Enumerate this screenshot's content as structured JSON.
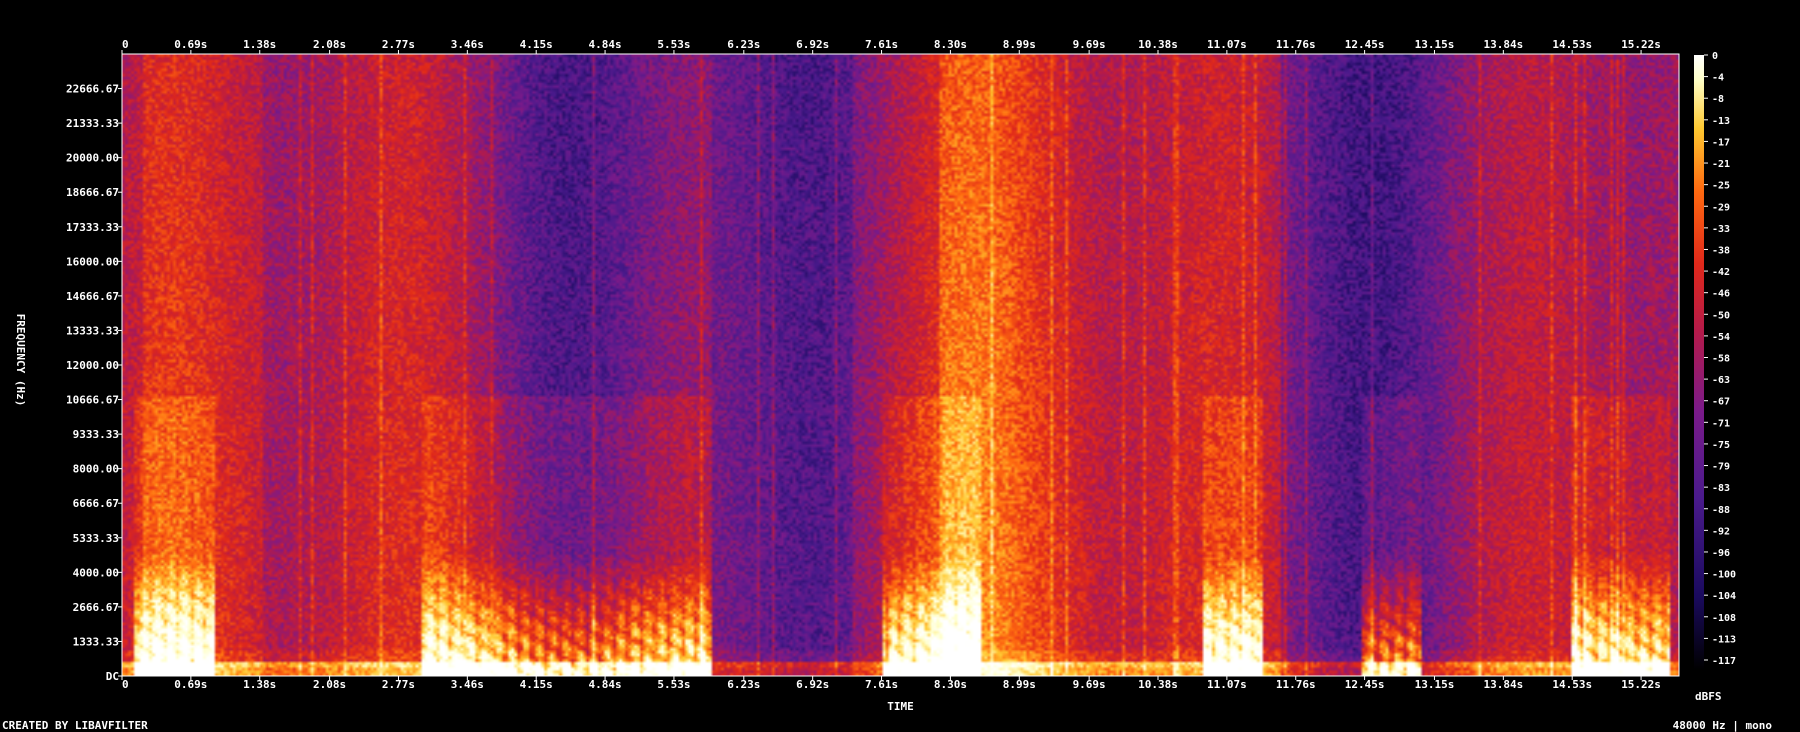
{
  "chart_data": {
    "type": "heatmap",
    "title": "",
    "xlabel": "TIME",
    "ylabel": "FREQUENCY (Hz)",
    "x_ticks": [
      "0",
      "0.69s",
      "1.38s",
      "2.08s",
      "2.77s",
      "3.46s",
      "4.15s",
      "4.84s",
      "5.53s",
      "6.23s",
      "6.92s",
      "7.61s",
      "8.30s",
      "8.99s",
      "9.69s",
      "10.38s",
      "11.07s",
      "11.76s",
      "12.45s",
      "13.15s",
      "13.84s",
      "14.53s",
      "15.22s"
    ],
    "x_tick_values": [
      0,
      0.69,
      1.38,
      2.08,
      2.77,
      3.46,
      4.15,
      4.84,
      5.53,
      6.23,
      6.92,
      7.61,
      8.3,
      8.99,
      9.69,
      10.38,
      11.07,
      11.76,
      12.45,
      13.15,
      13.84,
      14.53,
      15.22
    ],
    "y_ticks": [
      "22666.67",
      "21333.33",
      "20000.00",
      "18666.67",
      "17333.33",
      "16000.00",
      "14666.67",
      "13333.33",
      "12000.00",
      "10666.67",
      "9333.33",
      "8000.00",
      "6666.67",
      "5333.33",
      "4000.00",
      "2666.67",
      "1333.33",
      "DC"
    ],
    "y_tick_values": [
      22666.67,
      21333.33,
      20000,
      18666.67,
      17333.33,
      16000,
      14666.67,
      13333.33,
      12000,
      10666.67,
      9333.33,
      8000,
      6666.67,
      5333.33,
      4000,
      2666.67,
      1333.33,
      0
    ],
    "xlim": [
      0,
      15.6
    ],
    "ylim": [
      0,
      24000
    ],
    "colorbar": {
      "label": "dBFS",
      "ticks": [
        "0",
        "-4",
        "-8",
        "-13",
        "-17",
        "-21",
        "-25",
        "-29",
        "-33",
        "-38",
        "-42",
        "-46",
        "-50",
        "-54",
        "-58",
        "-63",
        "-67",
        "-71",
        "-75",
        "-79",
        "-83",
        "-88",
        "-92",
        "-96",
        "-100",
        "-104",
        "-108",
        "-113",
        "-117"
      ],
      "range": [
        -120,
        0
      ]
    },
    "speech_segments_s": [
      [
        0.1,
        0.9
      ],
      [
        3.0,
        5.9
      ],
      [
        7.6,
        8.6
      ],
      [
        10.8,
        11.4
      ],
      [
        12.4,
        13.0
      ],
      [
        14.5,
        15.5
      ]
    ],
    "colors": [
      "#000000",
      "#1a0a5e",
      "#4a1a8c",
      "#7a1a8a",
      "#b41a4a",
      "#e0281a",
      "#ff6a10",
      "#ffc830",
      "#ffffc8",
      "#ffffff"
    ]
  },
  "footer": {
    "left": "CREATED BY LIBAVFILTER",
    "right": "48000 Hz | mono"
  }
}
